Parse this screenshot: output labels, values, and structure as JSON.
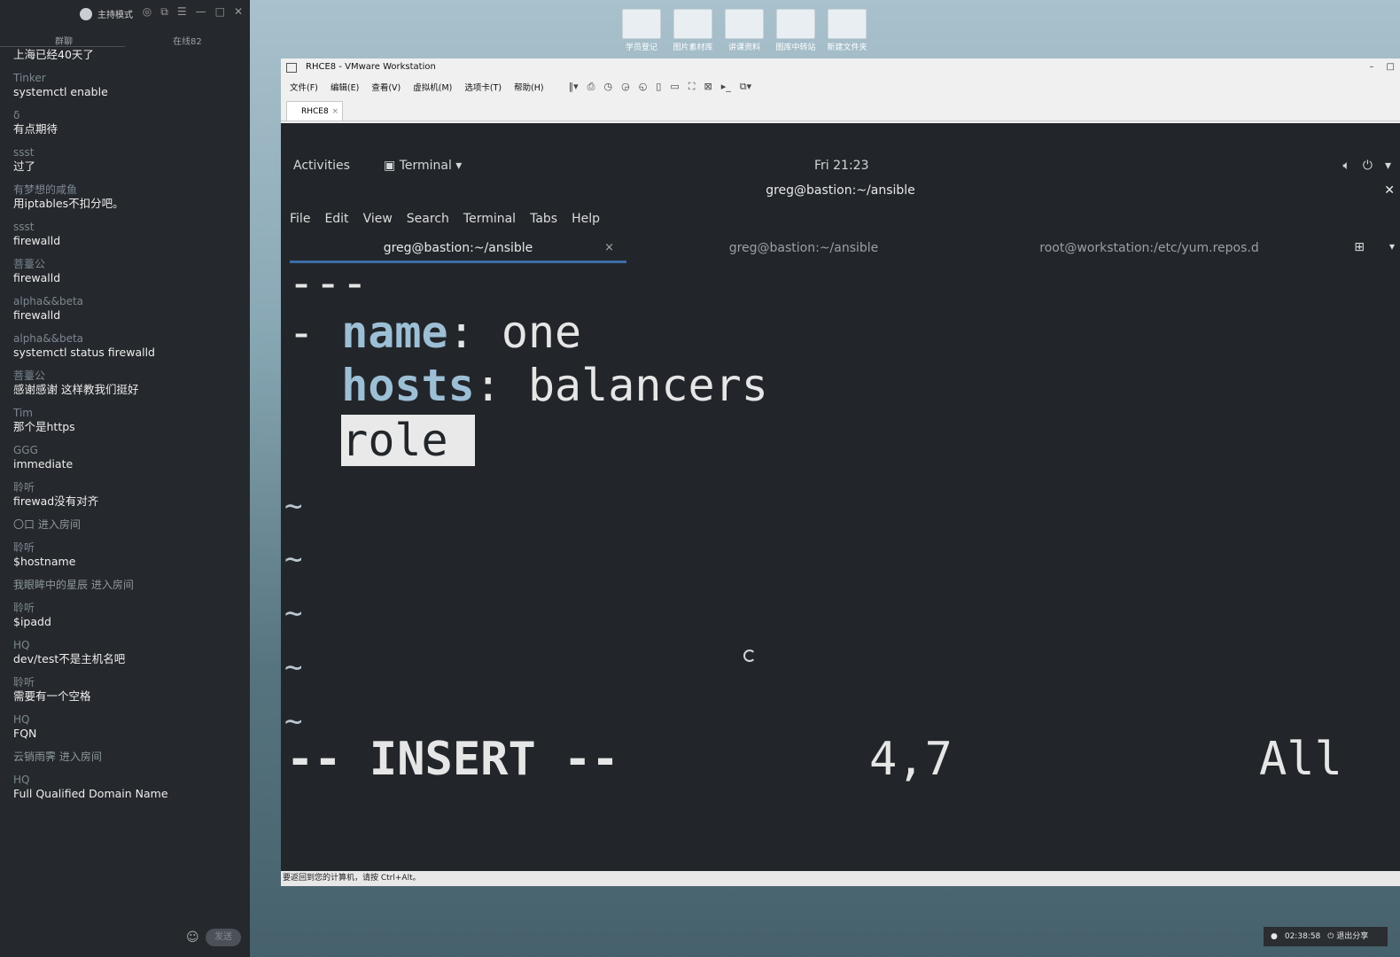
{
  "chat": {
    "mode_label": "主持模式",
    "tab_chat": "群聊",
    "tab_online": "在线82",
    "messages": [
      {
        "user": "",
        "text": "上海已经40天了"
      },
      {
        "user": "Tinker",
        "text": "systemctl enable"
      },
      {
        "user": "δ",
        "text": "有点期待"
      },
      {
        "user": "ssst",
        "text": "过了"
      },
      {
        "user": "有梦想的咸鱼",
        "text": "用iptables不扣分吧。"
      },
      {
        "user": "ssst",
        "text": "firewalld"
      },
      {
        "user": "菩薹公",
        "text": "firewalld"
      },
      {
        "user": "alpha&&beta",
        "text": "firewalld"
      },
      {
        "user": "alpha&&beta",
        "text": "systemctl status firewalld"
      },
      {
        "user": "菩薹公",
        "text": "感谢感谢 这样教我们挺好"
      },
      {
        "user": "Tim",
        "text": "那个是https"
      },
      {
        "user": "GGG",
        "text": "immediate"
      },
      {
        "user": "聆听",
        "text": "firewad没有对齐"
      },
      {
        "user": "",
        "text": "〇口 进入房间",
        "system": true
      },
      {
        "user": "聆听",
        "text": "$hostname"
      },
      {
        "user": "",
        "text": "我眼眸中的星辰 进入房间",
        "system": true
      },
      {
        "user": "聆听",
        "text": "$ipadd"
      },
      {
        "user": "HQ",
        "text": "dev/test不是主机名吧"
      },
      {
        "user": "聆听",
        "text": "需要有一个空格"
      },
      {
        "user": "HQ",
        "text": "FQN"
      },
      {
        "user": "",
        "text": "云销雨霁 进入房间",
        "system": true
      },
      {
        "user": "HQ",
        "text": "Full Qualified Domain Name"
      }
    ],
    "send_label": "发送"
  },
  "desktop_icons": [
    "学员登记",
    "图片素材库",
    "讲课资料",
    "图库中转站",
    "新建文件夹"
  ],
  "vmware": {
    "title": "RHCE8 - VMware Workstation",
    "menu": [
      "文件(F)",
      "编辑(E)",
      "查看(V)",
      "虚拟机(M)",
      "选项卡(T)",
      "帮助(H)"
    ],
    "tab_label": "RHCE8",
    "status_text": "要返回到您的计算机，请按 Ctrl+Alt。"
  },
  "gnome": {
    "activities": "Activities",
    "terminal_menu": "Terminal",
    "clock": "Fri 21:23"
  },
  "terminal": {
    "window_title": "greg@bastion:~/ansible",
    "menu": [
      "File",
      "Edit",
      "View",
      "Search",
      "Terminal",
      "Tabs",
      "Help"
    ],
    "tabs": [
      "greg@bastion:~/ansible",
      "greg@bastion:~/ansible",
      "root@workstation:/etc/yum.repos.d"
    ]
  },
  "editor": {
    "line1": "---",
    "line2_dash": "- ",
    "line2_key": "name",
    "line2_val": ": one",
    "line3_key": "hosts",
    "line3_val": ": balancers",
    "line4_text": "role",
    "mode": "-- INSERT --",
    "position": "4,7",
    "scroll": "All"
  },
  "share_bar": {
    "timer": "02:38:58",
    "exit_label": "退出分享"
  }
}
